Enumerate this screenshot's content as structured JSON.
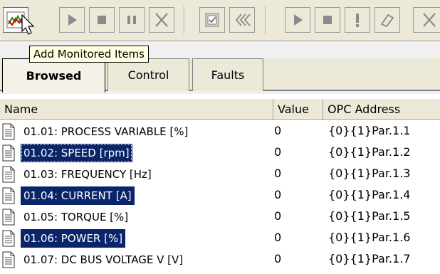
{
  "toolbar": {
    "buttons": [
      {
        "name": "add-monitored-items-button",
        "icon": "chart-line-icon"
      },
      {
        "name": "play-button",
        "icon": "play-icon"
      },
      {
        "name": "stop-button",
        "icon": "stop-icon"
      },
      {
        "name": "pause-button",
        "icon": "pause-icon"
      },
      {
        "name": "remove-button",
        "icon": "x-icon"
      },
      {
        "name": "properties-button",
        "icon": "properties-icon"
      },
      {
        "name": "rewind-button",
        "icon": "double-chevron-left-icon"
      },
      {
        "name": "run-button",
        "icon": "play-icon"
      },
      {
        "name": "stop-run-button",
        "icon": "stop-icon"
      },
      {
        "name": "fault-button",
        "icon": "exclamation-icon"
      },
      {
        "name": "erase-button",
        "icon": "eraser-icon"
      },
      {
        "name": "close-button",
        "icon": "x-icon"
      }
    ],
    "tooltip": "Add Monitored Items"
  },
  "tabs": [
    {
      "label": "Browsed",
      "active": true
    },
    {
      "label": "Control",
      "active": false
    },
    {
      "label": "Faults",
      "active": false
    }
  ],
  "columns": {
    "name": "Name",
    "value": "Value",
    "opc": "OPC Address"
  },
  "rows": [
    {
      "name": "01.01: PROCESS VARIABLE [%]",
      "value": "0",
      "opc": "{0}{1}Par.1.1",
      "selected": false
    },
    {
      "name": "01.02: SPEED [rpm]",
      "value": "0",
      "opc": "{0}{1}Par.1.2",
      "selected": true
    },
    {
      "name": "01.03: FREQUENCY [Hz]",
      "value": "0",
      "opc": "{0}{1}Par.1.3",
      "selected": false
    },
    {
      "name": "01.04: CURRENT [A]",
      "value": "0",
      "opc": "{0}{1}Par.1.4",
      "selected": true
    },
    {
      "name": "01.05: TORQUE [%]",
      "value": "0",
      "opc": "{0}{1}Par.1.5",
      "selected": false
    },
    {
      "name": "01.06: POWER [%]",
      "value": "0",
      "opc": "{0}{1}Par.1.6",
      "selected": true
    },
    {
      "name": "01.07: DC BUS VOLTAGE V [V]",
      "value": "0",
      "opc": "{0}{1}Par.1.7",
      "selected": false
    }
  ],
  "colors": {
    "selection": "#0a246a",
    "toolbar_bg": "#ece9d8"
  }
}
